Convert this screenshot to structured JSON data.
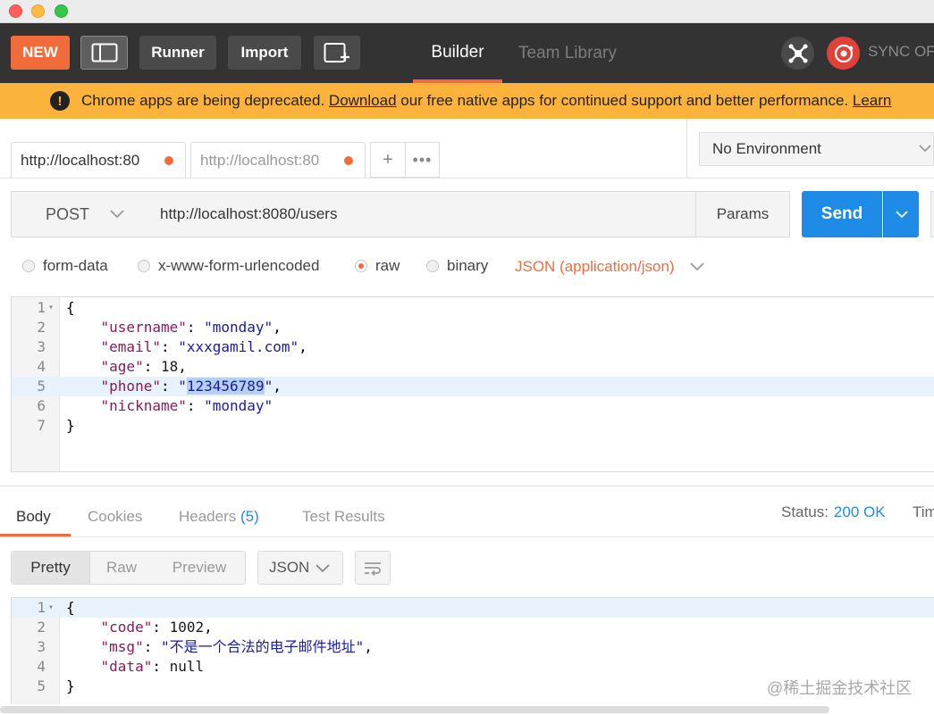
{
  "window": {
    "controls": [
      "close",
      "minimize",
      "zoom"
    ]
  },
  "header": {
    "new_label": "NEW",
    "runner_label": "Runner",
    "import_label": "Import",
    "tabs": [
      {
        "label": "Builder",
        "active": true
      },
      {
        "label": "Team Library",
        "active": false
      }
    ],
    "sync_label": "SYNC OFF",
    "accent": "#f26b3a"
  },
  "banner": {
    "text_before": "Chrome apps are being deprecated.",
    "link": "Download",
    "text_after": "our free native apps for continued support and better performance.",
    "learn": "Learn"
  },
  "request_tabs": [
    {
      "label": "http://localhost:80",
      "unsaved": true,
      "active": true
    },
    {
      "label": "http://localhost:80",
      "unsaved": true,
      "active": false
    }
  ],
  "environment": {
    "selected": "No Environment"
  },
  "request": {
    "method": "POST",
    "url": "http://localhost:8080/users",
    "params_label": "Params",
    "send_label": "Send"
  },
  "body_types": [
    {
      "label": "form-data",
      "selected": false
    },
    {
      "label": "x-www-form-urlencoded",
      "selected": false
    },
    {
      "label": "raw",
      "selected": true
    },
    {
      "label": "binary",
      "selected": false
    }
  ],
  "content_type": "JSON (application/json)",
  "request_body": {
    "line_numbers": [
      "1",
      "2",
      "3",
      "4",
      "5",
      "6",
      "7"
    ],
    "open_brace": "{",
    "close_brace": "}",
    "fields": [
      {
        "key": "\"username\"",
        "value": "\"monday\"",
        "sep": ","
      },
      {
        "key": "\"email\"",
        "value": "\"xxxgamil.com\"",
        "sep": ","
      },
      {
        "key": "\"age\"",
        "value": "18",
        "sep": ","
      },
      {
        "key": "\"phone\"",
        "value_prefix": "\"",
        "value_selected": "123456789",
        "value_suffix": "\"",
        "sep": ","
      },
      {
        "key": "\"nickname\"",
        "value": "\"monday\"",
        "sep": ""
      }
    ]
  },
  "response": {
    "tabs": [
      {
        "label": "Body",
        "active": true
      },
      {
        "label": "Cookies",
        "active": false
      },
      {
        "label": "Headers",
        "count": "(5)",
        "active": false
      },
      {
        "label": "Test Results",
        "active": false
      }
    ],
    "status_label": "Status:",
    "status_value": "200 OK",
    "time_label": "Time",
    "view_modes": [
      {
        "label": "Pretty",
        "active": true
      },
      {
        "label": "Raw",
        "active": false
      },
      {
        "label": "Preview",
        "active": false
      }
    ],
    "format": "JSON",
    "body": {
      "line_numbers": [
        "1",
        "2",
        "3",
        "4",
        "5"
      ],
      "open_brace": "{",
      "close_brace": "}",
      "fields": [
        {
          "key": "\"code\"",
          "value": "1002",
          "sep": ","
        },
        {
          "key": "\"msg\"",
          "value": "\"不是一个合法的电子邮件地址\"",
          "sep": ","
        },
        {
          "key": "\"data\"",
          "value": "null",
          "sep": ""
        }
      ]
    }
  },
  "watermark": "@稀土掘金技术社区"
}
